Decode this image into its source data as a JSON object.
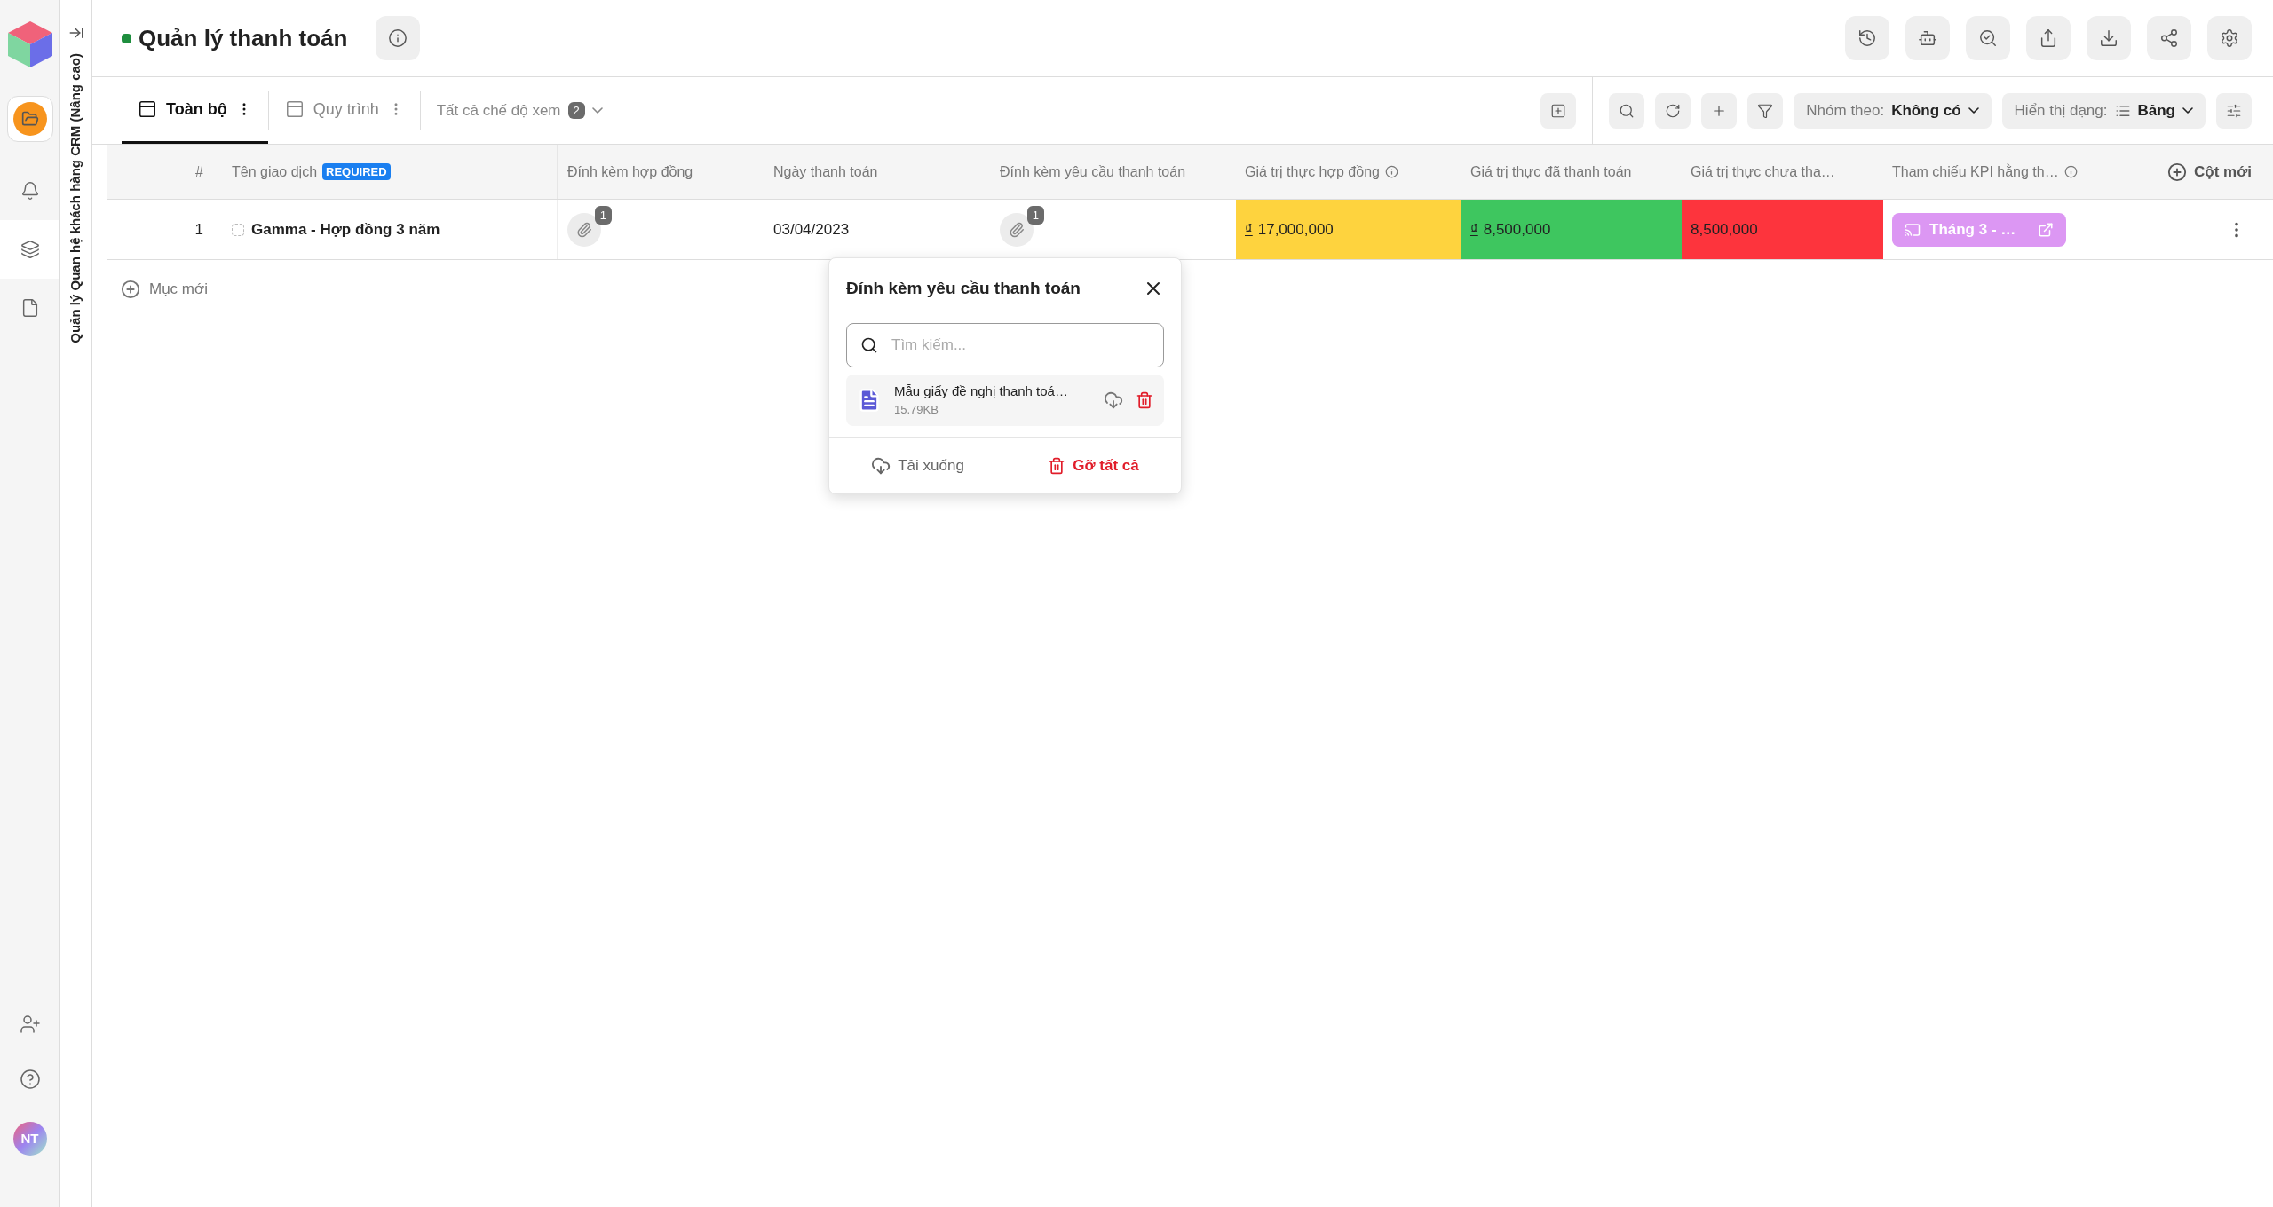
{
  "sidebar": {
    "nav": [
      {
        "kind": "bell"
      },
      {
        "kind": "layers"
      },
      {
        "kind": "file"
      }
    ],
    "avatar": "NT"
  },
  "workspace": {
    "title": "Quản lý Quan hệ khách hàng CRM (Nâng cao)"
  },
  "header": {
    "title": "Quản lý thanh toán"
  },
  "tabs": [
    {
      "label": "Toàn bộ",
      "selected": true
    },
    {
      "label": "Quy trình",
      "selected": false
    }
  ],
  "views": {
    "label": "Tất cả chế độ xem",
    "count": "2"
  },
  "group_by": {
    "label": "Nhóm theo:",
    "value": "Không có"
  },
  "display": {
    "label": "Hiển thị dạng:",
    "value": "Bảng"
  },
  "table": {
    "columns": [
      {
        "label": "#"
      },
      {
        "label": "Tên giao dịch",
        "badge": "REQUIRED"
      },
      {
        "label": "Đính kèm hợp đồng"
      },
      {
        "label": "Ngày thanh toán"
      },
      {
        "label": "Đính kèm yêu cầu thanh toán"
      },
      {
        "label": "Giá trị thực hợp đồng",
        "info": true
      },
      {
        "label": "Giá trị thực đã thanh toán"
      },
      {
        "label": "Giá trị thực chưa tha…"
      },
      {
        "label": "Tham chiếu KPI hằng th…",
        "info": true
      }
    ],
    "new_column": "Cột mới",
    "rows": [
      {
        "checked": false,
        "cells": [
          {
            "kind": "index",
            "text": "1"
          },
          {
            "kind": "title",
            "text": "Gamma - Hợp đồng 3 năm"
          },
          {
            "kind": "attachment",
            "count": "1"
          },
          {
            "kind": "text",
            "text": "03/04/2023"
          },
          {
            "kind": "attachment",
            "count": "1"
          },
          {
            "kind": "money",
            "currency": "₫",
            "text": "17,000,000",
            "color": "#fed33e"
          },
          {
            "kind": "money",
            "currency": "₫",
            "text": "8,500,000",
            "color": "#3ec65f"
          },
          {
            "kind": "money",
            "text": "8,500,000",
            "color": "#fd343d"
          },
          {
            "kind": "link",
            "text": "Tháng 3 - …",
            "color": "#dc97f3"
          }
        ]
      }
    ],
    "add_item": "Mục mới"
  },
  "popup": {
    "title": "Đính kèm yêu cầu thanh toán",
    "search": {
      "placeholder": "Tìm kiếm..."
    },
    "files": [
      {
        "name": "Mẫu giấy đề nghị thanh toá…",
        "size": "15.79KB"
      }
    ],
    "download": "Tải xuống",
    "remove_all": "Gỡ tất cả"
  }
}
